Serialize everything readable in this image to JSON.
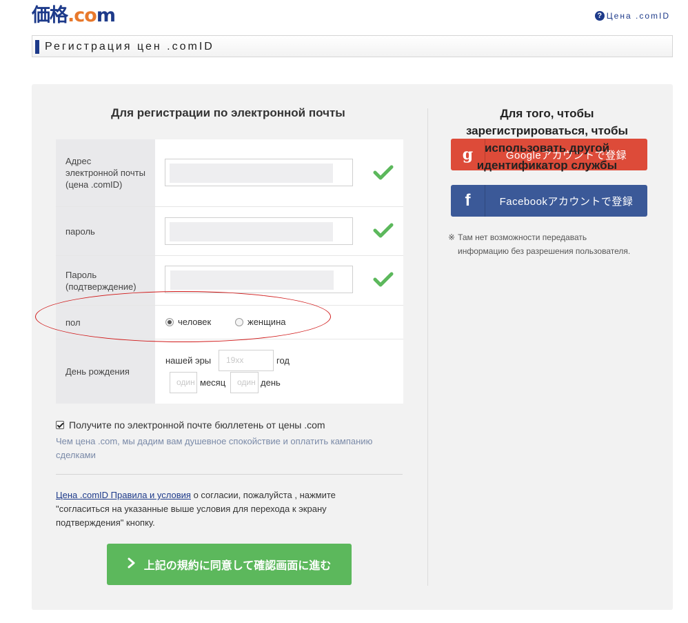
{
  "header": {
    "logo_part1": "価格",
    "logo_part2": ".co",
    "logo_part3": "m",
    "help_icon": "?",
    "help_link": "Цена .comID",
    "page_title": "Регистрация цен .comID"
  },
  "email_section": {
    "title": "Для регистрации по электронной почты",
    "fields": [
      {
        "label": "Адрес электронной почты (цена .comID)"
      },
      {
        "label": "пароль"
      },
      {
        "label": "Пароль (подтверждение)"
      }
    ],
    "gender": {
      "label": "пол",
      "options": [
        "человек",
        "женщина"
      ],
      "selected": "человек"
    },
    "birthday": {
      "label": "День рождения",
      "era": "нашей эры",
      "year_placeholder": "19xx",
      "year_unit": "год",
      "month_placeholder": "один",
      "month_unit": "месяц",
      "day_placeholder": "один",
      "day_unit": "день"
    },
    "newsletter": {
      "checkbox_label": "Получите по электронной почте бюллетень от цены .com",
      "checked": true,
      "description": "Чем цена .com, мы дадим вам душевное спокойствие и оплатить кампанию сделками"
    },
    "terms": {
      "link": "Цена .comID Правила и условия",
      "text": " о согласии, пожалуйста , нажмите \"согласиться на указанные выше условия для перехода к экрану подтверждения\" кнопку."
    },
    "submit_label": "上記の規約に同意して確認画面に進む"
  },
  "sns_section": {
    "title": "Для того, чтобы зарегистрироваться, чтобы использовать другой идентификатор службы",
    "google": {
      "icon": "g",
      "label": "Googleアカウントで登録"
    },
    "facebook": {
      "icon": "f",
      "label": "Facebookアカウントで登録"
    },
    "note_mark": "※",
    "note_line1": "Там нет возможности передавать",
    "note_line2": "информацию без разрешения пользователя."
  },
  "colors": {
    "brand_blue": "#1d3a8a",
    "brand_orange": "#e8792c",
    "check_green": "#5cb85c",
    "google_red": "#dd4b39",
    "facebook_blue": "#3b5998",
    "annotation_red": "#d01818"
  }
}
